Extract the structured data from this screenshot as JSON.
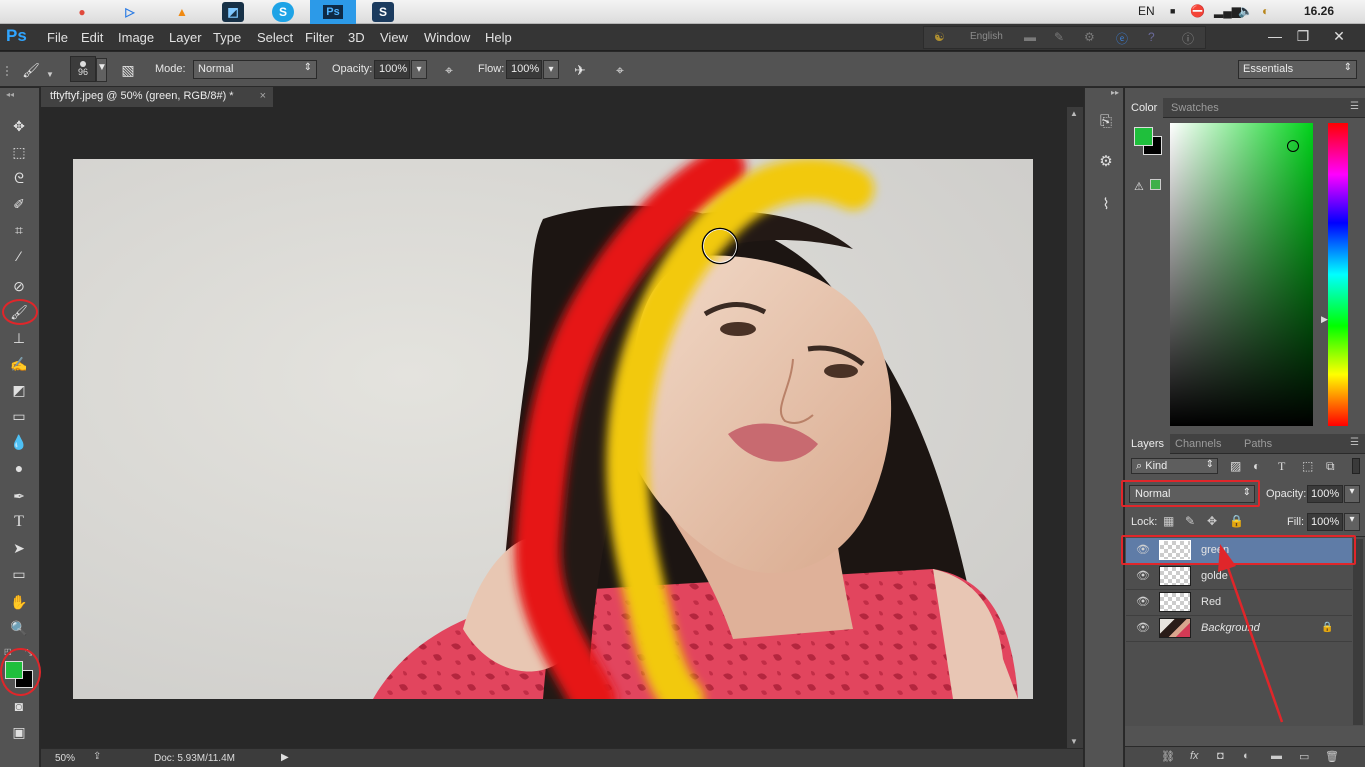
{
  "sysbar": {
    "apps": [
      {
        "name": "apple-logo",
        "glyph": ""
      },
      {
        "name": "chrome",
        "glyph": "●"
      },
      {
        "name": "player",
        "glyph": "▷"
      },
      {
        "name": "vlc",
        "glyph": "▲"
      },
      {
        "name": "ps-flat",
        "glyph": "◩"
      },
      {
        "name": "skype",
        "glyph": "S"
      },
      {
        "name": "photoshop",
        "glyph": "Ps"
      },
      {
        "name": "screen-recorder",
        "glyph": "S"
      }
    ],
    "lang": "EN",
    "clock": "16.26"
  },
  "menubar": {
    "logo": "Ps",
    "items": [
      "File",
      "Edit",
      "Image",
      "Layer",
      "Type",
      "Select",
      "Filter",
      "3D",
      "View",
      "Window",
      "Help"
    ],
    "language_field": "English",
    "window_controls": [
      "—",
      "❐",
      "✕"
    ]
  },
  "options": {
    "brush_size": "96",
    "mode_label": "Mode:",
    "mode_value": "Normal",
    "opacity_label": "Opacity:",
    "opacity_value": "100%",
    "flow_label": "Flow:",
    "flow_value": "100%",
    "workspace": "Essentials"
  },
  "document": {
    "tab_title": "tftyftyf.jpeg @ 50% (green, RGB/8#) *",
    "close_glyph": "×",
    "zoom": "50%",
    "doc_info": "Doc: 5.93M/11.4M"
  },
  "color_panel": {
    "tabs": [
      "Color",
      "Swatches"
    ],
    "foreground": "#1fbf3c",
    "background": "#000000"
  },
  "layers_panel": {
    "tabs": [
      "Layers",
      "Channels",
      "Paths"
    ],
    "filter_kind": "Kind",
    "blend_mode": "Normal",
    "opacity_label": "Opacity:",
    "opacity_value": "100%",
    "lock_label": "Lock:",
    "fill_label": "Fill:",
    "fill_value": "100%",
    "layers": [
      {
        "name": "green",
        "selected": true
      },
      {
        "name": "golde",
        "selected": false
      },
      {
        "name": "Red",
        "selected": false
      },
      {
        "name": "Background",
        "selected": false,
        "locked": true
      }
    ],
    "footer_icons": [
      "⛓",
      "fx",
      "◘",
      "◐",
      "▬",
      "▭",
      "🗑"
    ]
  },
  "colors": {
    "accent_red": "#e0262a",
    "paint_red": "#e61818",
    "paint_yellow": "#f2c90d",
    "selected_layer": "#5f7ca7"
  }
}
